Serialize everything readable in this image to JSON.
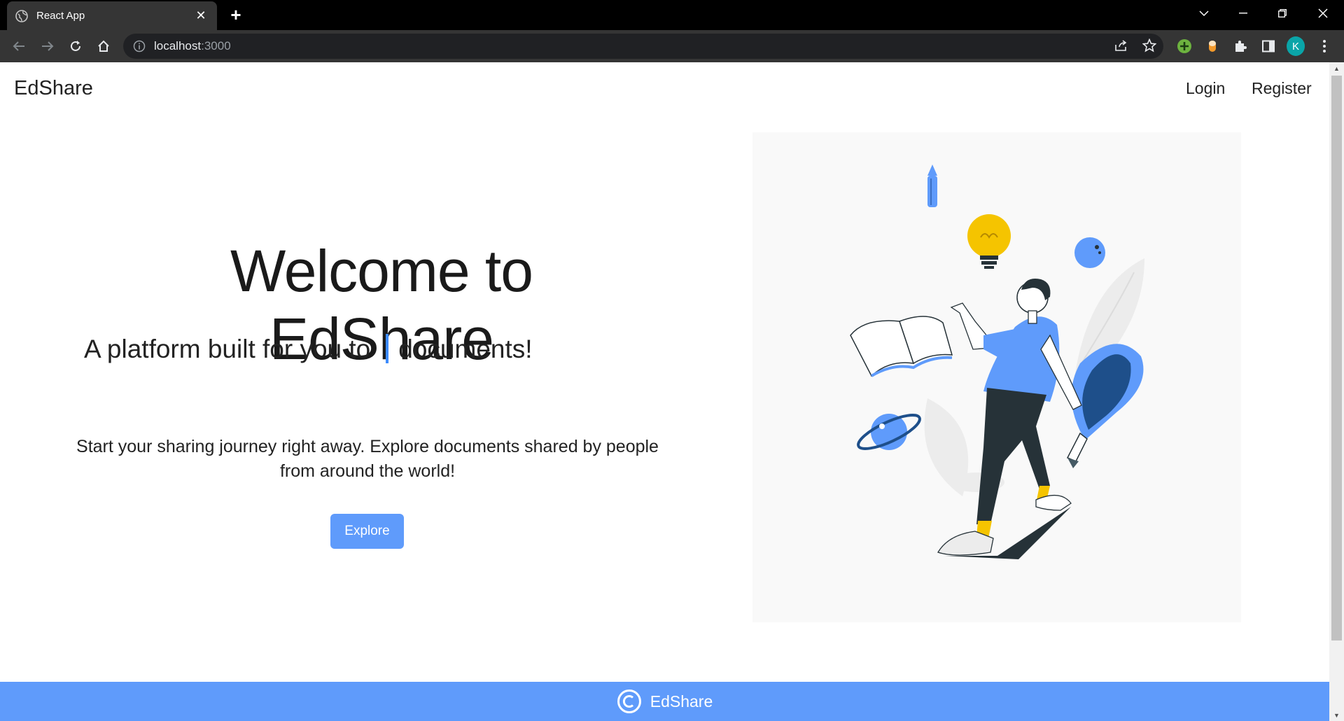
{
  "browser": {
    "tab_title": "React App",
    "url_host": "localhost",
    "url_port": ":3000",
    "profile_initial": "K"
  },
  "nav": {
    "brand": "EdShare",
    "login": "Login",
    "register": "Register"
  },
  "hero": {
    "title": "Welcome to EdShare",
    "tagline_before": "A platform built for you to",
    "tagline_after": "documents!",
    "description": "Start your sharing journey right away. Explore documents shared by people from around the world!",
    "button": "Explore"
  },
  "footer": {
    "text": "EdShare"
  },
  "colors": {
    "accent": "#5f9bfb",
    "illustration_bg": "#f9f9f9",
    "bulb": "#f5c400"
  }
}
